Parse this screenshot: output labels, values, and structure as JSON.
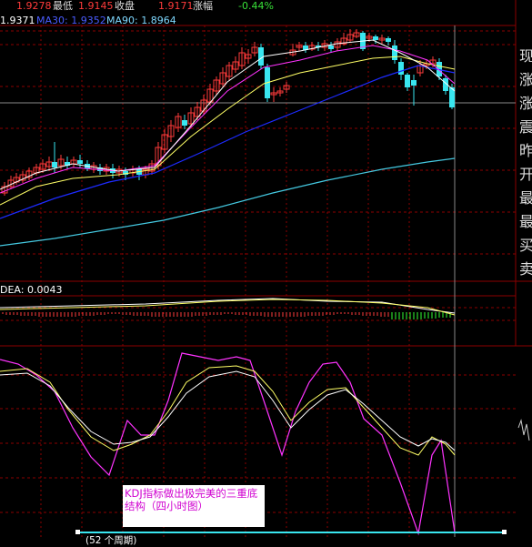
{
  "header": {
    "low_value": "1.9278",
    "low_label": "最低",
    "close_value": "1.9145",
    "close_label": "收盘",
    "change_value": "1.9171",
    "change_label": "涨幅",
    "change_pct": "-0.44%"
  },
  "ma_row": {
    "left_value": "1.9371",
    "ma30": "MA30: 1.9352",
    "ma90": "MA90: 1.8964"
  },
  "dea_label": "DEA: 0.0043",
  "sidebar_chars": [
    "现",
    "涨",
    "涨",
    "震",
    "昨",
    "开",
    "最",
    "最",
    "买",
    "卖"
  ],
  "annotation": {
    "line1": "KDJ指标做出极完美的三重底",
    "line2": "结构（四小时图）"
  },
  "bottom_label": "(52 个周期)",
  "colors": {
    "up": "#ff3b3b",
    "down": "#39e6f0",
    "ma5": "#ffffff",
    "ma10": "#ffff66",
    "ma20": "#ff33ff",
    "ma30": "#1d2bff",
    "ma90": "#44c8e0",
    "grid": "#8b0000"
  }
}
